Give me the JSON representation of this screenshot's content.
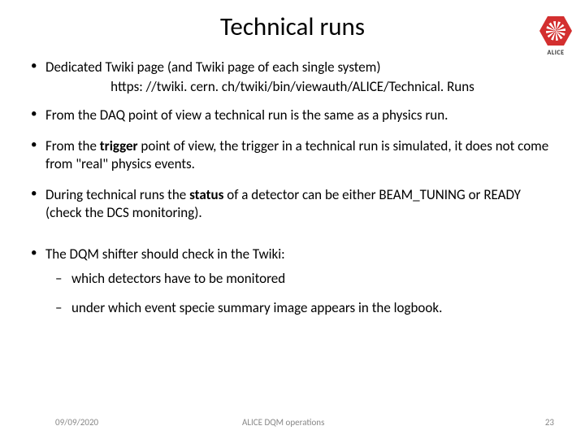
{
  "title": "Technical runs",
  "logo": {
    "label": "ALICE"
  },
  "bullets": {
    "b1": "Dedicated Twiki page (and Twiki page of each single system)",
    "link": "https: //twiki. cern. ch/twiki/bin/viewauth/ALICE/Technical. Runs",
    "b2": "From the DAQ point of view a technical run is the same as a physics run.",
    "b3_pre": "From the ",
    "b3_bold": "trigger",
    "b3_post": " point of view, the trigger in a technical run is simulated, it does not come from \"real\" physics events.",
    "b4_pre": "During technical runs the ",
    "b4_bold": "status",
    "b4_post": " of a detector can be either BEAM_TUNING or READY (check the DCS monitoring).",
    "b5": "The DQM shifter should check in the Twiki:",
    "b5a": "which detectors have to be monitored",
    "b5b": "under which event specie summary image appears in the logbook."
  },
  "footer": {
    "date": "09/09/2020",
    "title": "ALICE DQM operations",
    "page": "23"
  }
}
